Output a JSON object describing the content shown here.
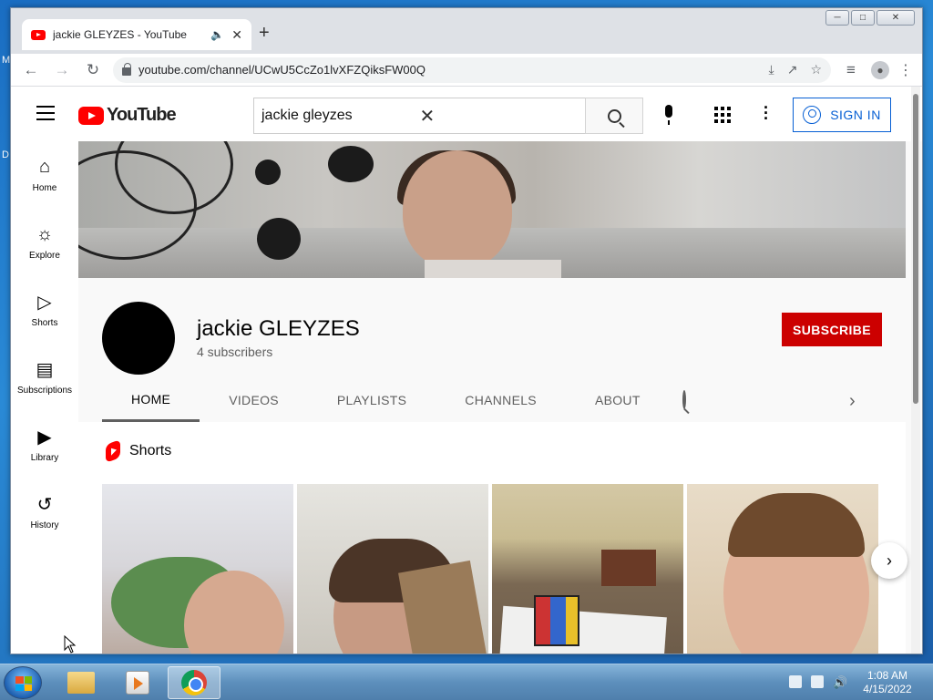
{
  "browser": {
    "tab_title": "jackie GLEYZES - YouTube",
    "tab_audio_icon": "speaker-icon",
    "url": "youtube.com/channel/UCwU5CcZo1lvXFZQiksFW00Q",
    "window_controls": {
      "minimize": "─",
      "maximize": "□",
      "close": "✕"
    }
  },
  "youtube": {
    "logo_text": "YouTube",
    "search_value": "jackie gleyzes",
    "sign_in_label": "SIGN IN",
    "guide": [
      {
        "label": "Home",
        "icon": "home-icon"
      },
      {
        "label": "Explore",
        "icon": "compass-icon"
      },
      {
        "label": "Shorts",
        "icon": "shorts-icon"
      },
      {
        "label": "Subscriptions",
        "icon": "subscriptions-icon"
      },
      {
        "label": "Library",
        "icon": "library-icon"
      },
      {
        "label": "History",
        "icon": "history-icon"
      }
    ],
    "channel": {
      "name": "jackie GLEYZES",
      "subscribers": "4 subscribers",
      "subscribe_label": "SUBSCRIBE"
    },
    "tabs": [
      "HOME",
      "VIDEOS",
      "PLAYLISTS",
      "CHANNELS",
      "ABOUT"
    ],
    "active_tab": "HOME",
    "shelf_title": "Shorts"
  },
  "taskbar": {
    "time": "1:08 AM",
    "date": "4/15/2022"
  },
  "colors": {
    "youtube_red": "#ff0000",
    "subscribe_red": "#cc0000",
    "link_blue": "#065fd4"
  }
}
